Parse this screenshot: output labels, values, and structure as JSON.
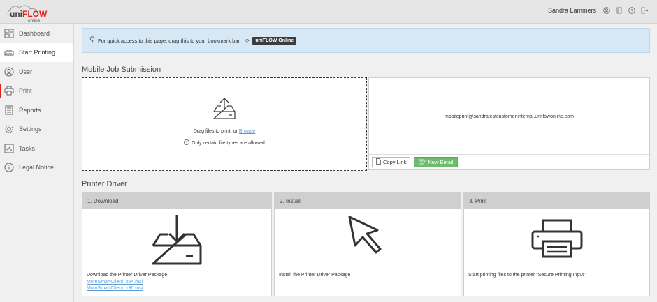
{
  "header": {
    "logo_main": "uniFLOW",
    "logo_sub": "online",
    "user_name": "Sandra Lammers",
    "icons": [
      "user-icon",
      "book-icon",
      "help-icon",
      "logout-icon"
    ]
  },
  "sidebar": {
    "items": [
      {
        "label": "Dashboard",
        "icon": "dashboard-icon"
      },
      {
        "label": "Start Printing",
        "icon": "printer-tray-icon"
      },
      {
        "label": "User",
        "icon": "user-icon"
      },
      {
        "label": "Print",
        "icon": "print-icon"
      },
      {
        "label": "Reports",
        "icon": "reports-icon"
      },
      {
        "label": "Settings",
        "icon": "gear-icon"
      },
      {
        "label": "Tasks",
        "icon": "tasks-icon"
      },
      {
        "label": "Legal Notice",
        "icon": "info-icon"
      }
    ]
  },
  "banner": {
    "text": "For quick access to this page, drag this to your bookmark bar",
    "bookmark_label": "uniFLOW Online"
  },
  "mobile": {
    "title": "Mobile Job Submission",
    "drop_text": "Drag files to print, or",
    "browse_link": "Browse",
    "note": "Only certain file types are allowed",
    "email": "mobileprint@sandratestcustomer.internal.uniflowonline.com",
    "copy_label": "Copy Link",
    "new_email_label": "New Email"
  },
  "driver": {
    "title": "Printer Driver",
    "cards": [
      {
        "head": "1. Download",
        "text": "Download the Printer Driver Package",
        "links": [
          "MomSmartClient_x64.msi",
          "MomSmartClient_x86.msi"
        ]
      },
      {
        "head": "2. Install",
        "text": "Install the Printer Driver Package"
      },
      {
        "head": "3. Print",
        "text": "Start printing files to the printer \"Secure Printing Input\""
      }
    ]
  },
  "colors": {
    "accent_red": "#e2231a",
    "banner_bg": "#d6e8f5",
    "button_green": "#6ebd6e",
    "link_blue": "#5b9bd5"
  }
}
